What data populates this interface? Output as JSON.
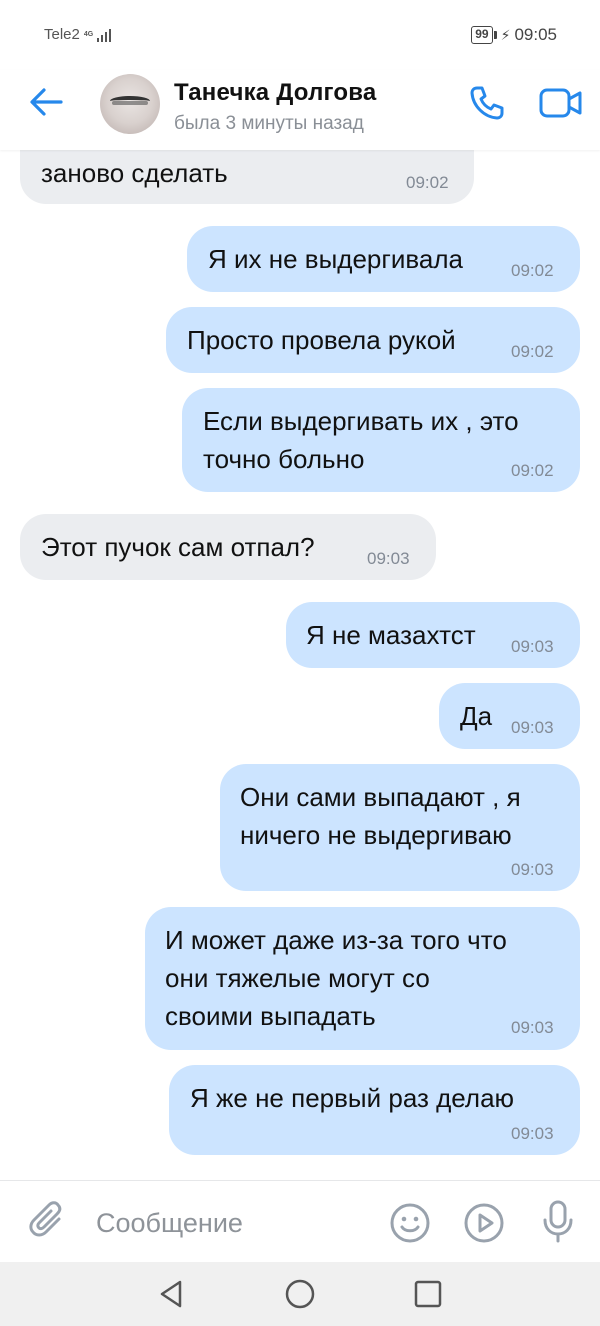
{
  "status_bar": {
    "carrier": "Tele2",
    "network_type": "4G",
    "battery": "99",
    "time": "09:05"
  },
  "header": {
    "contact_name": "Танечка Долгова",
    "contact_status": "была 3 минуты назад"
  },
  "messages": [
    {
      "direction": "in",
      "lines": [
        "заново сделать"
      ],
      "time": "09:02"
    },
    {
      "direction": "out",
      "lines": [
        "Я их не выдергивала"
      ],
      "time": "09:02"
    },
    {
      "direction": "out",
      "lines": [
        "Просто провела рукой"
      ],
      "time": "09:02"
    },
    {
      "direction": "out",
      "lines": [
        "Если выдергивать их , это",
        "точно больно"
      ],
      "time": "09:02"
    },
    {
      "direction": "in",
      "lines": [
        "Этот пучок сам отпал?"
      ],
      "time": "09:03"
    },
    {
      "direction": "out",
      "lines": [
        "Я не мазахтст"
      ],
      "time": "09:03"
    },
    {
      "direction": "out",
      "lines": [
        "Да"
      ],
      "time": "09:03"
    },
    {
      "direction": "out",
      "lines": [
        "Они сами выпадают , я",
        "ничего не выдергиваю"
      ],
      "time": "09:03"
    },
    {
      "direction": "out",
      "lines": [
        "И может даже из-за того что",
        "они тяжелые могут со",
        "своими выпадать"
      ],
      "time": "09:03"
    },
    {
      "direction": "out",
      "lines": [
        "Я же не первый раз делаю"
      ],
      "time": "09:03"
    }
  ],
  "input_bar": {
    "placeholder": "Сообщение"
  },
  "icons": {
    "back": "arrow-left-icon",
    "call": "phone-icon",
    "video": "video-camera-icon",
    "attach": "paperclip-icon",
    "emoji": "smile-icon",
    "gif": "play-circle-icon",
    "mic": "microphone-icon"
  },
  "colors": {
    "accent": "#2688eb",
    "incoming_bubble": "#ebedf0",
    "outgoing_bubble": "#cce4ff",
    "time_text": "#828a95"
  }
}
